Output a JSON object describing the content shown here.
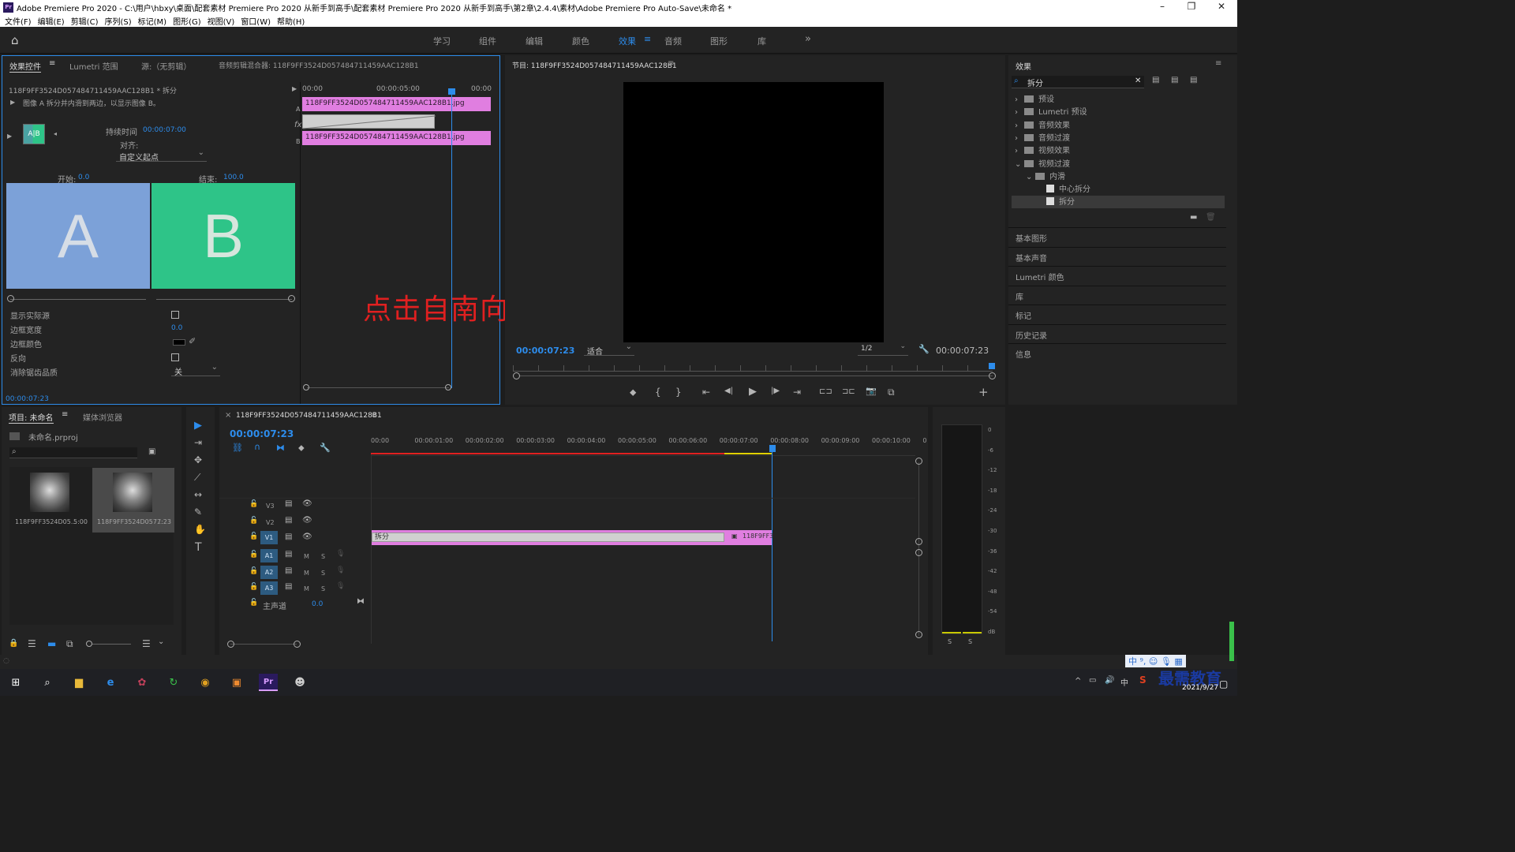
{
  "window": {
    "app_badge": "Pr",
    "title": "Adobe Premiere Pro 2020 - C:\\用户\\hbxy\\桌面\\配套素材 Premiere Pro 2020 从新手到高手\\配套素材 Premiere Pro 2020 从新手到高手\\第2章\\2.4.4\\素材\\Adobe Premiere Pro Auto-Save\\未命名 *",
    "minimize": "–",
    "restore": "❐",
    "close": "✕"
  },
  "menu": [
    "文件(F)",
    "编辑(E)",
    "剪辑(C)",
    "序列(S)",
    "标记(M)",
    "图形(G)",
    "视图(V)",
    "窗口(W)",
    "帮助(H)"
  ],
  "workspaces": {
    "items": [
      "学习",
      "组件",
      "编辑",
      "颜色",
      "效果",
      "音频",
      "图形",
      "库"
    ],
    "active_index": 4,
    "more": "»"
  },
  "effect_controls": {
    "tabs": [
      "效果控件",
      "Lumetri 范围",
      "源:（无剪辑）",
      "音频剪辑混合器: 118F9FF3524D057484711459AAC128B1"
    ],
    "clip_path": "118F9FF3524D057484711459AAC128B1 * 拆分",
    "description": "图像 A 拆分并内滑到两边，以显示图像 B。",
    "duration_label": "持续时间",
    "duration_value": "00:00:07:00",
    "alignment_label": "对齐:",
    "alignment_value": "自定义起点",
    "start_label": "开始:",
    "start_value": "0.0",
    "end_label": "结束:",
    "end_value": "100.0",
    "preview_a": "A",
    "preview_b": "B",
    "thumb_label": "A|B",
    "props": [
      {
        "label": "显示实际源"
      },
      {
        "label": "边框宽度",
        "value": "0.0"
      },
      {
        "label": "边框颜色"
      },
      {
        "label": "反向"
      },
      {
        "label": "消除锯齿品质",
        "value": "关"
      }
    ],
    "timecode": "00:00:07:23",
    "mini_ruler": [
      "00:00",
      "00:00:05:00",
      "00:00"
    ],
    "track_a": "118F9FF3524D057484711459AAC128B1.jpg",
    "track_b": "118F9FF3524D057484711459AAC128B1.jpg",
    "label_a": "A",
    "label_b": "B",
    "fx": "fx"
  },
  "overlay_text": "点击自南向北",
  "program_monitor": {
    "title": "节目: 118F9FF3524D057484711459AAC128B1",
    "timecode_left": "00:00:07:23",
    "fit": "适合",
    "resolution": "1/2",
    "timecode_right": "00:00:07:23",
    "controls": [
      "⬥",
      "{",
      "}",
      "⇤",
      "◀|",
      "▶",
      "|▶",
      "⇥",
      "⊏⊐",
      "⊐⊏",
      "📷",
      "⧉"
    ],
    "add": "+"
  },
  "effects_panel": {
    "title": "效果",
    "search_value": "拆分",
    "tree": [
      {
        "label": "预设",
        "level": 0,
        "arrow": "›"
      },
      {
        "label": "Lumetri 预设",
        "level": 0,
        "arrow": "›"
      },
      {
        "label": "音频效果",
        "level": 0,
        "arrow": "›"
      },
      {
        "label": "音频过渡",
        "level": 0,
        "arrow": "›"
      },
      {
        "label": "视频效果",
        "level": 0,
        "arrow": "›"
      },
      {
        "label": "视频过渡",
        "level": 0,
        "arrow": "⌄"
      },
      {
        "label": "内滑",
        "level": 1,
        "arrow": "⌄"
      },
      {
        "label": "中心拆分",
        "level": 2,
        "arrow": ""
      },
      {
        "label": "拆分",
        "level": 2,
        "arrow": "",
        "selected": true
      }
    ],
    "sections": [
      "基本图形",
      "基本声音",
      "Lumetri 颜色",
      "库",
      "标记",
      "历史记录",
      "信息"
    ]
  },
  "project_panel": {
    "tabs": [
      "项目: 未命名",
      "媒体浏览器"
    ],
    "project_file": "未命名.prproj",
    "items": [
      {
        "name": "118F9FF3524D05...",
        "duration": "5:00"
      },
      {
        "name": "118F9FF3524D057...",
        "duration": "7:23"
      }
    ]
  },
  "tools": [
    "▶",
    "⇥",
    "✥",
    "⟋",
    "↔",
    "✎",
    "✋",
    "T"
  ],
  "timeline": {
    "close": "×",
    "sequence_name": "118F9FF3524D057484711459AAC128B1",
    "timecode": "00:00:07:23",
    "ruler": [
      "00:00",
      "00:00:01:00",
      "00:00:02:00",
      "00:00:03:00",
      "00:00:04:00",
      "00:00:05:00",
      "00:00:06:00",
      "00:00:07:00",
      "00:00:08:00",
      "00:00:09:00",
      "00:00:10:00",
      "0"
    ],
    "video_tracks": [
      "V3",
      "V2",
      "V1"
    ],
    "audio_tracks": [
      "A1",
      "A2",
      "A3"
    ],
    "master_label": "主声道",
    "master_value": "0.0",
    "transition_label": "拆分",
    "clip_label": "118F9FF3",
    "m_label": "M",
    "s_label": "S"
  },
  "audio_meter": {
    "scale": [
      "0",
      "-6",
      "-12",
      "-18",
      "-24",
      "-30",
      "-36",
      "-42",
      "-48",
      "-54",
      "dB"
    ],
    "solo": [
      "S",
      "S"
    ]
  },
  "taskbar": {
    "tray": "中 ⁹, ☺ 🎙 ▦",
    "clock_date": "2021/9/27",
    "watermark": "最需教育"
  },
  "colors": {
    "accent_blue": "#2d8ceb",
    "clip_pink": "#e07ee0",
    "tile_a": "#7ca1d8",
    "tile_b": "#2ec488",
    "overlay_red": "#e02020"
  }
}
